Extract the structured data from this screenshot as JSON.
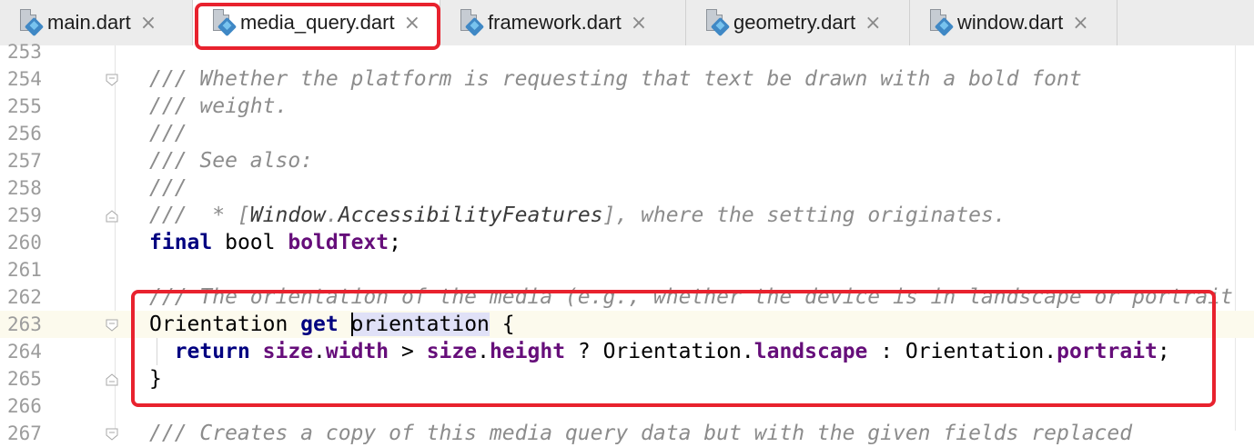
{
  "tabs": [
    {
      "label": "main.dart",
      "icon": "dart-file-icon",
      "active": false
    },
    {
      "label": "media_query.dart",
      "icon": "dart-file-icon",
      "active": true
    },
    {
      "label": "framework.dart",
      "icon": "dart-file-icon",
      "active": false
    },
    {
      "label": "geometry.dart",
      "icon": "dart-file-icon",
      "active": false
    },
    {
      "label": "window.dart",
      "icon": "dart-file-icon",
      "active": false
    }
  ],
  "close_glyph": "×",
  "highlight_color": "#e8222e",
  "editor": {
    "current_line": "263",
    "lines": [
      {
        "n": "253",
        "segs": []
      },
      {
        "n": "254",
        "segs": [
          {
            "c": "cm",
            "t": "/// Whether the platform is requesting that text be drawn with a bold font"
          }
        ]
      },
      {
        "n": "255",
        "segs": [
          {
            "c": "cm",
            "t": "/// weight."
          }
        ]
      },
      {
        "n": "256",
        "segs": [
          {
            "c": "cm",
            "t": "///"
          }
        ]
      },
      {
        "n": "257",
        "segs": [
          {
            "c": "cm",
            "t": "/// See also:"
          }
        ]
      },
      {
        "n": "258",
        "segs": [
          {
            "c": "cm",
            "t": "///"
          }
        ]
      },
      {
        "n": "259",
        "segs": [
          {
            "c": "cm",
            "t": "///  * ["
          },
          {
            "c": "cmref",
            "t": "Window"
          },
          {
            "c": "cm",
            "t": "."
          },
          {
            "c": "cmref",
            "t": "AccessibilityFeatures"
          },
          {
            "c": "cm",
            "t": "], where the setting originates."
          }
        ]
      },
      {
        "n": "260",
        "segs": [
          {
            "c": "kw",
            "t": "final"
          },
          {
            "c": "id",
            "t": " bool "
          },
          {
            "c": "fld",
            "t": "boldText"
          },
          {
            "c": "id",
            "t": ";"
          }
        ]
      },
      {
        "n": "261",
        "segs": []
      },
      {
        "n": "262",
        "segs": [
          {
            "c": "cm",
            "t": "/// The orientation of the media (e.g., whether the device is in landscape or portrait"
          }
        ]
      },
      {
        "n": "263",
        "segs": [
          {
            "c": "id",
            "t": "Orientation "
          },
          {
            "c": "kw",
            "t": "get"
          },
          {
            "c": "id",
            "t": " "
          },
          {
            "c": "caret",
            "t": ""
          },
          {
            "c": "id id-hl",
            "t": "orientation"
          },
          {
            "c": "id",
            "t": " {"
          }
        ]
      },
      {
        "n": "264",
        "segs": [
          {
            "c": "id",
            "t": "  "
          },
          {
            "c": "kw",
            "t": "return"
          },
          {
            "c": "id",
            "t": " "
          },
          {
            "c": "fld",
            "t": "size"
          },
          {
            "c": "id",
            "t": "."
          },
          {
            "c": "fld",
            "t": "width"
          },
          {
            "c": "id",
            "t": " > "
          },
          {
            "c": "fld",
            "t": "size"
          },
          {
            "c": "id",
            "t": "."
          },
          {
            "c": "fld",
            "t": "height"
          },
          {
            "c": "id",
            "t": " ? Orientation."
          },
          {
            "c": "fld",
            "t": "landscape"
          },
          {
            "c": "id",
            "t": " : Orientation."
          },
          {
            "c": "fld",
            "t": "portrait"
          },
          {
            "c": "id",
            "t": ";"
          }
        ]
      },
      {
        "n": "265",
        "segs": [
          {
            "c": "id",
            "t": "}"
          }
        ]
      },
      {
        "n": "266",
        "segs": []
      },
      {
        "n": "267",
        "segs": [
          {
            "c": "cm",
            "t": "/// Creates a copy of this media query data but with the given fields replaced"
          }
        ]
      }
    ]
  }
}
